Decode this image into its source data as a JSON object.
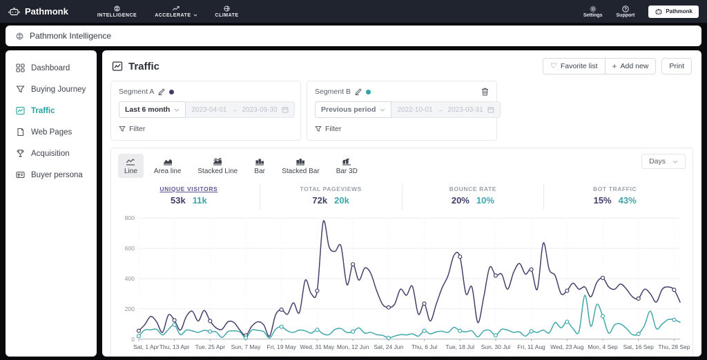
{
  "topbar": {
    "brand": "Pathmonk",
    "nav": [
      {
        "label": "INTELLIGENCE"
      },
      {
        "label": "ACCELERATE"
      },
      {
        "label": "CLIMATE"
      }
    ],
    "settings_label": "Settings",
    "support_label": "Support",
    "account_button": "Pathmonk"
  },
  "subbar": {
    "title": "Pathmonk Intelligence"
  },
  "sidebar": {
    "items": [
      {
        "label": "Dashboard"
      },
      {
        "label": "Buying Journey"
      },
      {
        "label": "Traffic"
      },
      {
        "label": "Web Pages"
      },
      {
        "label": "Acquisition"
      },
      {
        "label": "Buyer persona"
      }
    ]
  },
  "page": {
    "title": "Traffic",
    "favorite_label": "Favorite list",
    "add_new_label": "Add new",
    "print_label": "Print"
  },
  "segments": {
    "a": {
      "name": "Segment A",
      "period": "Last 6 month",
      "date_from": "2023-04-01",
      "date_to": "2023-09-30",
      "arrow": "→",
      "filter_label": "Filter",
      "color": "#3f3c68"
    },
    "b": {
      "name": "Segment B",
      "period": "Previous period",
      "date_from": "2022-10-01",
      "date_to": "2023-03-31",
      "arrow": "→",
      "filter_label": "Filter",
      "color": "#2fa3a6"
    }
  },
  "chart_controls": {
    "tabs": [
      {
        "label": "Line"
      },
      {
        "label": "Area line"
      },
      {
        "label": "Stacked Line"
      },
      {
        "label": "Bar"
      },
      {
        "label": "Stacked Bar"
      },
      {
        "label": "Bar 3D"
      }
    ],
    "granularity": "Days"
  },
  "stats": [
    {
      "label": "UNIQUE VISITORS",
      "a": "53k",
      "b": "11k"
    },
    {
      "label": "TOTAL PAGEVIEWS",
      "a": "72k",
      "b": "20k"
    },
    {
      "label": "BOUNCE RATE",
      "a": "20%",
      "b": "10%"
    },
    {
      "label": "BOT TRAFFIC",
      "a": "15%",
      "b": "43%"
    }
  ],
  "chart_data": {
    "type": "line",
    "title": "Daily unique visitors, Segment A (2023-04-01 to 2023-09-30) vs Segment B (previous period)",
    "x_description": "days, one value every 2 days from Sat 1 Apr to Sat 30 Sep 2023",
    "tick_labels": [
      "Sat, 1 Apr",
      "Thu, 13 Apr",
      "Tue, 25 Apr",
      "Sun, 7 May",
      "Fri, 19 May",
      "Wed, 31 May",
      "Mon, 12 Jun",
      "Sat, 24 Jun",
      "Thu, 6 Jul",
      "Tue, 18 Jul",
      "Sun, 30 Jul",
      "Fri, 11 Aug",
      "Wed, 23 Aug",
      "Mon, 4 Sep",
      "Sat, 16 Sep",
      "Thu, 28 Sep"
    ],
    "tick_point_indices": [
      0,
      6,
      12,
      18,
      24,
      30,
      36,
      42,
      48,
      54,
      60,
      66,
      72,
      78,
      84,
      90
    ],
    "ylim": [
      0,
      800
    ],
    "y_ticks": [
      0,
      200,
      400,
      600,
      800
    ],
    "grid": true,
    "legend": "none",
    "marker_every": 6,
    "series": [
      {
        "name": "Segment A",
        "color": "#433f6b",
        "values": [
          55,
          95,
          150,
          115,
          45,
          160,
          125,
          60,
          150,
          185,
          120,
          190,
          120,
          75,
          65,
          115,
          110,
          60,
          25,
          85,
          115,
          95,
          20,
          160,
          195,
          165,
          240,
          175,
          390,
          300,
          320,
          775,
          610,
          580,
          615,
          360,
          495,
          390,
          470,
          435,
          320,
          230,
          210,
          230,
          330,
          290,
          350,
          165,
          235,
          120,
          230,
          340,
          420,
          555,
          545,
          300,
          345,
          110,
          280,
          475,
          420,
          430,
          330,
          440,
          500,
          430,
          460,
          330,
          635,
          460,
          420,
          300,
          320,
          370,
          330,
          345,
          280,
          375,
          405,
          345,
          330,
          365,
          330,
          280,
          268,
          330,
          300,
          245,
          330,
          345,
          326,
          245
        ]
      },
      {
        "name": "Segment B",
        "color": "#3fa7a9",
        "values": [
          20,
          60,
          62,
          65,
          28,
          65,
          95,
          30,
          60,
          55,
          45,
          58,
          50,
          48,
          12,
          50,
          55,
          48,
          10,
          60,
          58,
          50,
          8,
          65,
          82,
          55,
          45,
          60,
          55,
          40,
          62,
          35,
          30,
          65,
          70,
          45,
          50,
          75,
          40,
          45,
          30,
          25,
          8,
          20,
          30,
          28,
          35,
          20,
          55,
          35,
          48,
          52,
          45,
          78,
          55,
          48,
          55,
          15,
          55,
          58,
          25,
          65,
          60,
          45,
          48,
          20,
          52,
          45,
          60,
          42,
          110,
          75,
          115,
          70,
          50,
          290,
          85,
          230,
          152,
          40,
          95,
          100,
          70,
          30,
          35,
          90,
          185,
          70,
          100,
          130,
          128,
          112
        ]
      }
    ]
  }
}
